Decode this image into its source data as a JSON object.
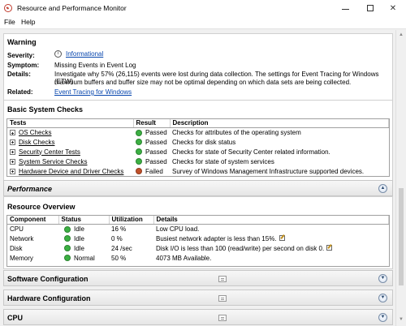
{
  "window": {
    "title": "Resource and Performance Monitor"
  },
  "menu": {
    "file": "File",
    "help": "Help"
  },
  "warning": {
    "title": "Warning",
    "severity_label": "Severity:",
    "severity_value": "Informational",
    "symptom_label": "Symptom:",
    "symptom_value": "Missing Events in Event Log",
    "details_label": "Details:",
    "details_line1": "Investigate why 57% (26,115) events were lost during data collection. The settings for Event Tracing for Windows (ETW)",
    "details_line2": "maximum buffers and buffer size may not be optimal depending on which data sets are being collected.",
    "related_label": "Related:",
    "related_value": "Event Tracing for Windows"
  },
  "checks": {
    "title": "Basic System Checks",
    "headers": {
      "tests": "Tests",
      "result": "Result",
      "description": "Description"
    },
    "rows": [
      {
        "test": "OS Checks",
        "result": "Passed",
        "status_color": "#3cb043",
        "description": "Checks for attributes of the operating system"
      },
      {
        "test": "Disk Checks",
        "result": "Passed",
        "status_color": "#3cb043",
        "description": "Checks for disk status"
      },
      {
        "test": "Security Center Tests",
        "result": "Passed",
        "status_color": "#3cb043",
        "description": "Checks for state of Security Center related information."
      },
      {
        "test": "System Service Checks",
        "result": "Passed",
        "status_color": "#3cb043",
        "description": "Checks for state of system services"
      },
      {
        "test": "Hardware Device and Driver Checks",
        "result": "Failed",
        "status_color": "#c0502a",
        "description": "Survey of Windows Management Infrastructure supported devices."
      }
    ]
  },
  "performance": {
    "title": "Performance"
  },
  "resources": {
    "title": "Resource Overview",
    "headers": {
      "component": "Component",
      "status": "Status",
      "utilization": "Utilization",
      "details": "Details"
    },
    "rows": [
      {
        "component": "CPU",
        "status": "Idle",
        "status_color": "#3cb043",
        "utilization": "16 %",
        "details": "Low CPU load."
      },
      {
        "component": "Network",
        "status": "Idle",
        "status_color": "#3cb043",
        "utilization": "0 %",
        "details": "Busiest network adapter is less than 15%."
      },
      {
        "component": "Disk",
        "status": "Idle",
        "status_color": "#3cb043",
        "utilization": "24 /sec",
        "details": "Disk I/O is less than 100 (read/write) per second on disk 0."
      },
      {
        "component": "Memory",
        "status": "Normal",
        "status_color": "#3cb043",
        "utilization": "50 %",
        "details": "4073 MB Available."
      }
    ]
  },
  "collapsed_sections": {
    "software": "Software Configuration",
    "hardware": "Hardware Configuration",
    "cpu": "CPU"
  },
  "icons": {
    "app": "resource-monitor-icon",
    "info": "info-icon",
    "expand": "plus-box-icon",
    "chevron": "chevron-circle-icon",
    "edit": "edit-icon"
  }
}
